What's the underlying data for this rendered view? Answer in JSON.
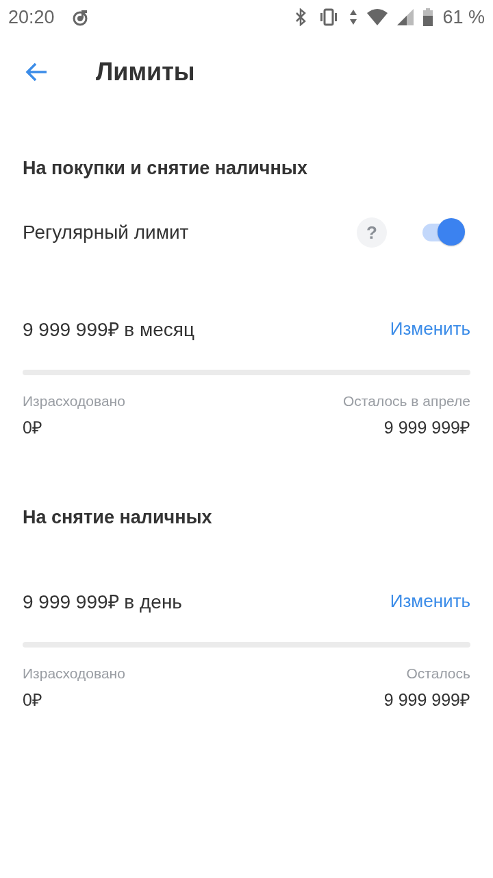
{
  "status_bar": {
    "time": "20:20",
    "battery": "61 %"
  },
  "header": {
    "title": "Лимиты"
  },
  "sections": [
    {
      "heading": "На покупки и снятие наличных",
      "toggle": {
        "label": "Регулярный лимит",
        "help": "?",
        "on": true
      },
      "amount": "9 999 999₽ в месяц",
      "action": "Изменить",
      "level": 0,
      "spent_label": "Израсходовано",
      "spent": "0₽",
      "left_label": "Осталось в апреле",
      "left": "9 999 999₽"
    },
    {
      "heading": "На снятие наличных",
      "amount": "9 999 999₽ в день",
      "action": "Изменить",
      "level": 0,
      "spent_label": "Израсходовано",
      "spent": "0₽",
      "left_label": "Осталось",
      "left": "9 999 999₽"
    }
  ]
}
